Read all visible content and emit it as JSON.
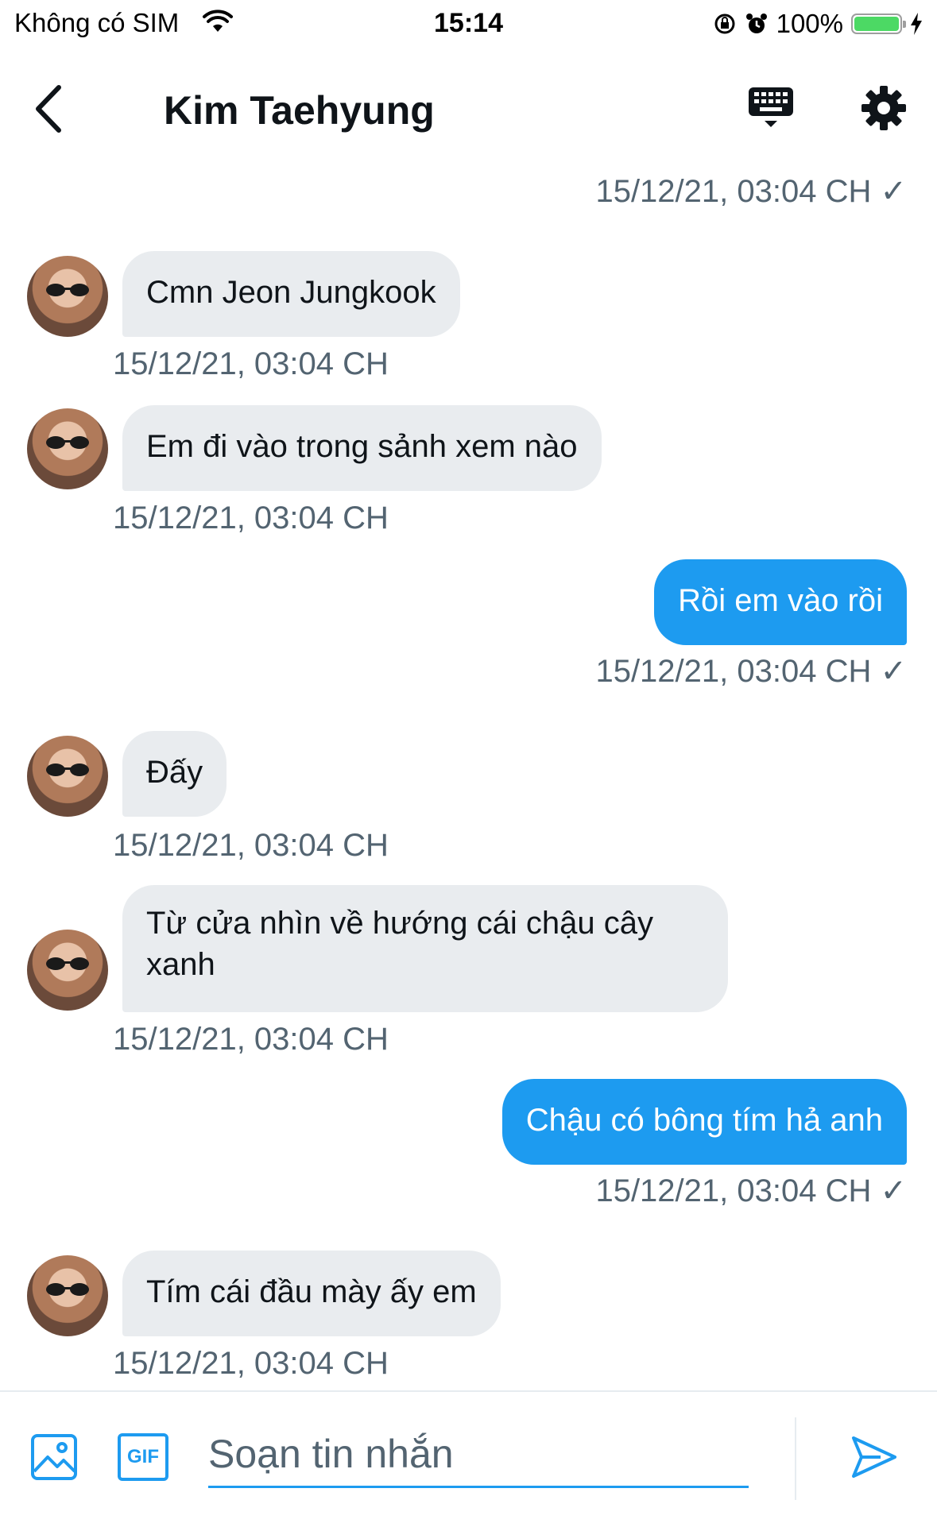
{
  "status_bar": {
    "carrier": "Không có SIM",
    "time": "15:14",
    "battery": "100%",
    "battery_level": 1.0
  },
  "header": {
    "title": "Kim Taehyung"
  },
  "messages": [
    {
      "side": "out",
      "timestamp": "15/12/21, 03:04 CH ✓"
    },
    {
      "side": "in",
      "text": "Cmn Jeon Jungkook",
      "timestamp": "15/12/21, 03:04 CH"
    },
    {
      "side": "in",
      "text": "Em đi vào trong sảnh xem nào",
      "timestamp": "15/12/21, 03:04 CH"
    },
    {
      "side": "out",
      "text": "Rồi em vào rồi",
      "timestamp": "15/12/21, 03:04 CH ✓"
    },
    {
      "side": "in",
      "text": "Đấy",
      "timestamp": "15/12/21, 03:04 CH"
    },
    {
      "side": "in",
      "text": "Từ cửa nhìn về hướng cái chậu cây xanh",
      "timestamp": "15/12/21, 03:04 CH"
    },
    {
      "side": "out",
      "text": "Chậu có bông tím hả anh",
      "timestamp": "15/12/21, 03:04 CH ✓"
    },
    {
      "side": "in",
      "text": "Tím cái đầu mày ấy em",
      "timestamp": "15/12/21, 03:04 CH"
    }
  ],
  "composer": {
    "placeholder": "Soạn tin nhắn",
    "gif_label": "GIF"
  },
  "colors": {
    "accent": "#1d9bf0",
    "incoming_bubble": "#e9ecef",
    "timestamp": "#536471"
  }
}
